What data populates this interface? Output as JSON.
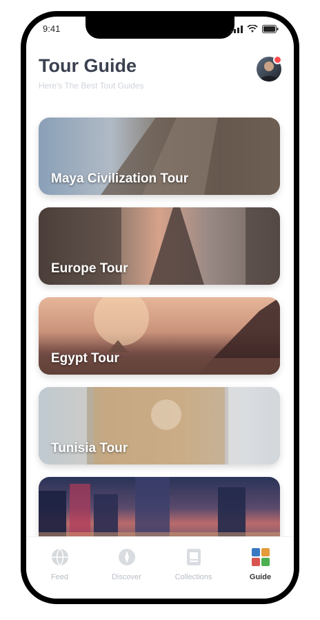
{
  "status": {
    "time": "9:41"
  },
  "header": {
    "title": "Tour Guide",
    "subtitle": "Here's The Best Tout Guides"
  },
  "cards": [
    {
      "label": "Maya Civilization Tour"
    },
    {
      "label": "Europe Tour"
    },
    {
      "label": "Egypt Tour"
    },
    {
      "label": "Tunisia Tour"
    },
    {
      "label": ""
    }
  ],
  "tabs": [
    {
      "label": "Feed",
      "icon": "globe-icon"
    },
    {
      "label": "Discover",
      "icon": "compass-icon"
    },
    {
      "label": "Collections",
      "icon": "collection-icon"
    },
    {
      "label": "Guide",
      "icon": "guide-icon"
    }
  ],
  "colors": {
    "title": "#3b4150",
    "notification": "#ff4d4f"
  }
}
